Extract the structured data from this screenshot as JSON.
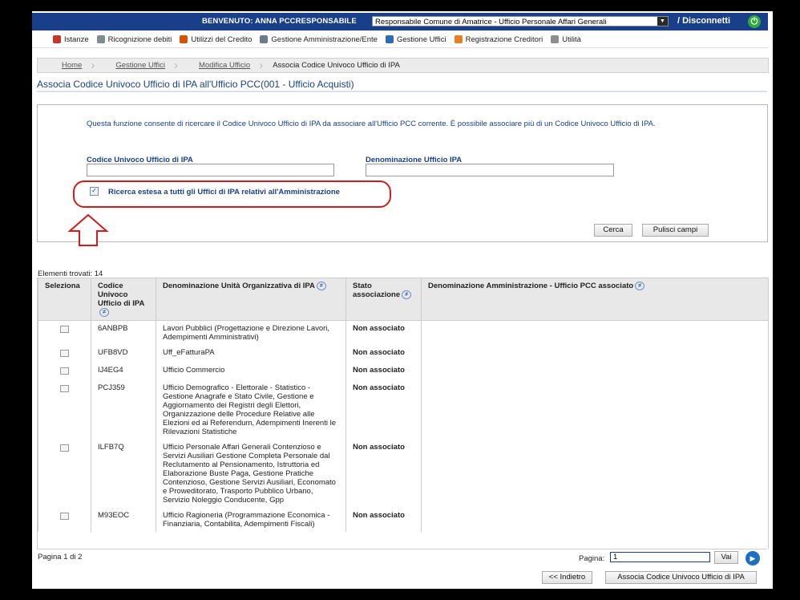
{
  "header": {
    "welcome": "BENVENUTO: ANNA PCCRESPONSABILE",
    "ente_selected": "Responsabile Comune di Amatrice - Ufficio Personale Affari Generali",
    "disconnect": "/ Disconnetti"
  },
  "menu": [
    {
      "label": "Istanze",
      "icon": "istanze-icon",
      "color": "#c0392b"
    },
    {
      "label": "Ricognizione debiti",
      "icon": "document-icon",
      "color": "#7f8c8d"
    },
    {
      "label": "Utilizzi del Credito",
      "icon": "person-icon",
      "color": "#d35400"
    },
    {
      "label": "Gestione Amministrazione/Ente",
      "icon": "building-icon",
      "color": "#6c7a89"
    },
    {
      "label": "Gestione Uffici",
      "icon": "network-icon",
      "color": "#2e6db4"
    },
    {
      "label": "Registrazione Creditori",
      "icon": "user-icon",
      "color": "#e67e22"
    },
    {
      "label": "Utilità",
      "icon": "tools-icon",
      "color": "#8e8e8e"
    }
  ],
  "breadcrumb": [
    "Home",
    "Gestione Uffici",
    "Modifica Ufficio",
    "Associa Codice Univoco Ufficio di IPA"
  ],
  "page_title": "Associa Codice Univoco Ufficio di IPA all'Ufficio PCC(001 - Ufficio Acquisti)",
  "search": {
    "description": "Questa funzione consente di ricercare il Codice Univoco Ufficio di IPA da associare all'Ufficio PCC corrente. È possibile associare più di un Codice Univoco Ufficio di IPA.",
    "codice_label": "Codice Univoco Ufficio di IPA",
    "codice_value": "",
    "denominazione_label": "Denominazione Ufficio IPA",
    "denominazione_value": "",
    "extended_label": "Ricerca estesa a tutti gli Uffici di IPA relativi all'Amministrazione",
    "extended_checked": true,
    "cerca": "Cerca",
    "pulisci": "Pulisci campi"
  },
  "results": {
    "found_label": "Elementi trovati: 14",
    "columns": {
      "seleziona": "Seleziona",
      "codice": "Codice Univoco Ufficio di IPA",
      "denominazione": "Denominazione Unità Organizzativa di IPA",
      "stato": "Stato associazione",
      "amministrazione": "Denominazione Amministrazione - Ufficio PCC associato"
    },
    "rows": [
      {
        "codice": "6ANBPB",
        "denominazione": "Lavori Pubblici (Progettazione e Direzione Lavori, Adempimenti Amministrativi)",
        "stato": "Non associato",
        "amministrazione": ""
      },
      {
        "codice": "UFB8VD",
        "denominazione": "Uff_eFatturaPA",
        "stato": "Non associato",
        "amministrazione": ""
      },
      {
        "codice": "IJ4EG4",
        "denominazione": "Ufficio Commercio",
        "stato": "Non associato",
        "amministrazione": ""
      },
      {
        "codice": "PCJ359",
        "denominazione": "Ufficio Demografico - Elettorale - Statistico - Gestione Anagrafe e Stato Civile, Gestione e Aggiornamento dei Registri degli Elettori, Organizzazione delle Procedure Relative alle Elezioni ed ai Referendum, Adempimenti Inerenti le Rilevazioni Statistiche",
        "stato": "Non associato",
        "amministrazione": ""
      },
      {
        "codice": "ILFB7Q",
        "denominazione": "Ufficio Personale Affari Generali Contenzioso e Servizi Ausiliari Gestione Completa Personale dal Reclutamento al Pensionamento, Istruttoria ed Elaborazione Buste Paga, Gestione Pratiche Contenzioso, Gestione Servizi Ausiliari, Economato e Proweditorato, Trasporto Pubblico Urbano, Servizio Noleggio Conducente, Gpp",
        "stato": "Non associato",
        "amministrazione": ""
      },
      {
        "codice": "M93EOC",
        "denominazione": "Ufficio Ragioneria (Programmazione Economica - Finanziaria, Contabilita, Adempimenti Fiscali)",
        "stato": "Non associato",
        "amministrazione": ""
      }
    ]
  },
  "pagination": {
    "info": "Pagina 1 di 2",
    "label": "Pagina:",
    "value": "1",
    "go": "Vai"
  },
  "actions": {
    "back": "<< Indietro",
    "associate": "Associa Codice Univoco Ufficio di IPA"
  },
  "colors": {
    "header_bg": "#1a3f8a",
    "title_blue": "#1a3f8a",
    "highlight_red": "#d41c1c",
    "power_green": "#2eaa3d"
  }
}
